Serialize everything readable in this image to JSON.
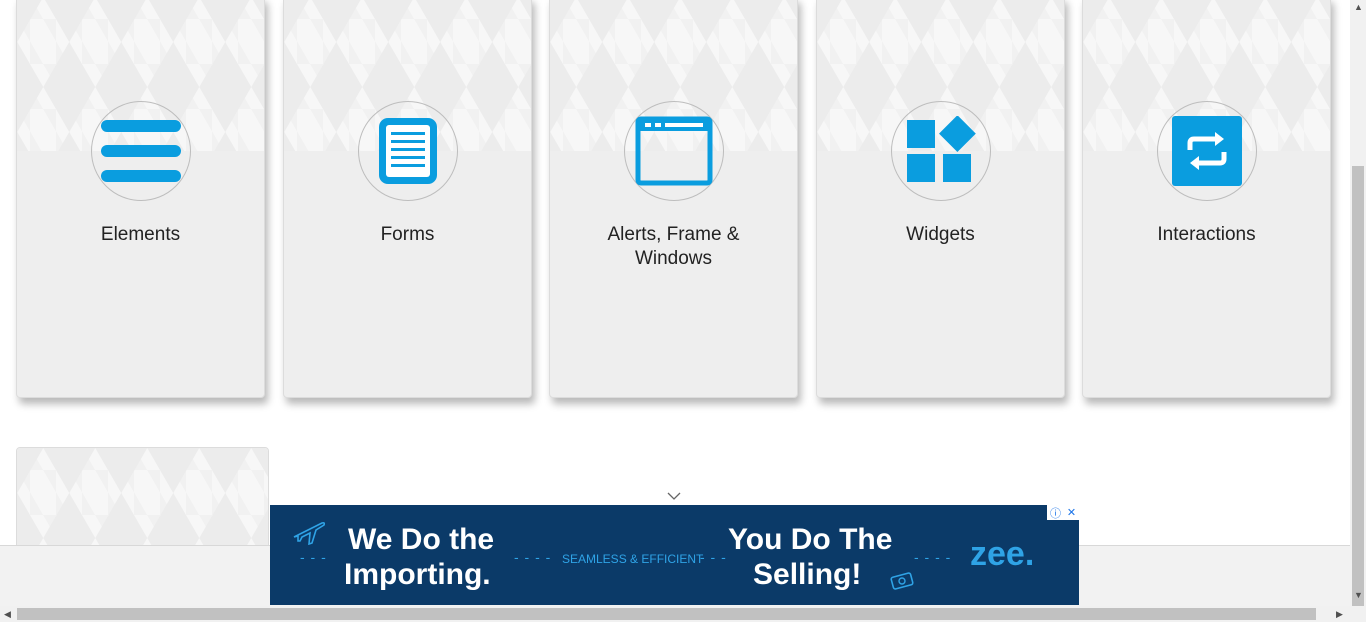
{
  "cards": [
    {
      "title": "Elements",
      "icon": "menu-lines-icon"
    },
    {
      "title": "Forms",
      "icon": "document-icon"
    },
    {
      "title": "Alerts, Frame & Windows",
      "icon": "browser-window-icon"
    },
    {
      "title": "Widgets",
      "icon": "widgets-icon"
    },
    {
      "title": "Interactions",
      "icon": "swap-arrows-icon"
    }
  ],
  "ad": {
    "line1a": "We Do the",
    "line1b": "Importing.",
    "middle": "SEAMLESS & EFFICIENT",
    "line2a": "You Do The",
    "line2b": "Selling!",
    "brand": "zee.",
    "info": "ⓘ",
    "close": "✕"
  },
  "colors": {
    "accent": "#0a9ddf",
    "ad_bg": "#0b3a68",
    "card_bg": "#eeeeee"
  }
}
